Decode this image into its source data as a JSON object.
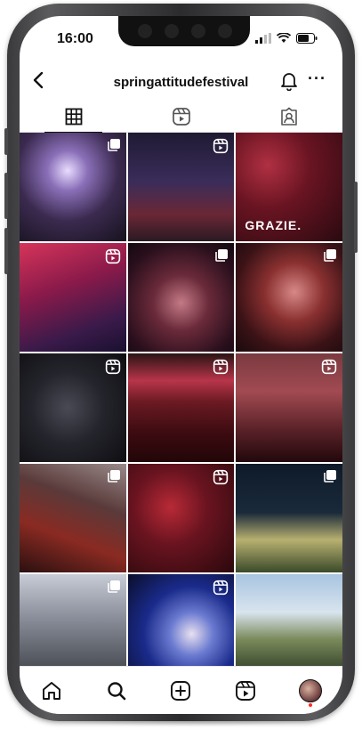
{
  "status_bar": {
    "time": "16:00"
  },
  "header": {
    "username": "springattitudefestival",
    "more_label": "···"
  },
  "tabs": [
    {
      "icon": "grid-icon",
      "active": true
    },
    {
      "icon": "reels-icon",
      "active": false
    },
    {
      "icon": "tagged-icon",
      "active": false
    }
  ],
  "posts": [
    {
      "type": "multi",
      "overlay_text": "",
      "bg": "radial-gradient(circle at 45% 35%, #e8dcff 0%, #8a6fb8 22%, #3b2a4f 55%, #16121e 100%)"
    },
    {
      "type": "reel",
      "overlay_text": "",
      "bg": "linear-gradient(180deg,#1f1a33 0%,#3a2d5a 45%,#6a2736 75%,#2a1a22 100%)"
    },
    {
      "type": "none",
      "overlay_text": "GRAZIE.",
      "bg": "radial-gradient(circle at 30% 30%, #b03042 0%, #6a1422 40%, #2a0a10 100%)"
    },
    {
      "type": "reel",
      "overlay_text": "",
      "bg": "linear-gradient(160deg,#d6345a 0%,#8a1a4a 40%,#3a1a4a 75%,#1a1030 100%)"
    },
    {
      "type": "multi",
      "overlay_text": "",
      "bg": "radial-gradient(circle at 50% 55%, #c47a86 0%, #6a2a3a 35%, #2a0f1c 75%, #120810 100%)"
    },
    {
      "type": "multi",
      "overlay_text": "",
      "bg": "radial-gradient(circle at 55% 45%, #d88888 0%, #8a3030 35%, #3a1216 70%, #1a0a0c 100%)"
    },
    {
      "type": "reel",
      "overlay_text": "",
      "bg": "radial-gradient(circle at 45% 50%, #4a4a55 0%, #24242c 45%, #0e0e12 100%)"
    },
    {
      "type": "reel",
      "overlay_text": "",
      "bg": "linear-gradient(180deg,#2a1414 0%,#b8344a 25%,#6a1a22 45%,#3a0a10 75%,#220608 100%)"
    },
    {
      "type": "reel",
      "overlay_text": "",
      "bg": "linear-gradient(180deg,#7a3a40 0%,#a24a52 35%,#5a2228 70%,#22080c 100%)"
    },
    {
      "type": "multi",
      "overlay_text": "",
      "bg": "linear-gradient(200deg,#9a8a8a 0%,#5a3a3a 35%,#8a2a22 65%,#2a1010 100%)"
    },
    {
      "type": "reel",
      "overlay_text": "",
      "bg": "radial-gradient(circle at 40% 40%, #b82a36 0%, #6a1420 40%, #2a080c 100%)"
    },
    {
      "type": "multi",
      "overlay_text": "",
      "bg": "linear-gradient(180deg,#0e1a2a 0%,#1a2a3a 45%,#b8b070 70%,#3a4a2a 100%)"
    },
    {
      "type": "multi",
      "overlay_text": "",
      "bg": "linear-gradient(180deg,#c8ccd6 0%,#8a8e9a 40%,#5a5e66 75%,#3a3c42 100%)"
    },
    {
      "type": "reel",
      "overlay_text": "",
      "bg": "radial-gradient(circle at 60% 55%, #e8e0f0 0%, #6a7ad0 25%, #1a2a8a 55%, #0a0e2a 100%)"
    },
    {
      "type": "none",
      "overlay_text": "",
      "bg": "linear-gradient(180deg,#a8c4e0 0%,#d8e4ee 35%,#7a8a5a 60%,#4a5a3a 80%,#2a2e2a 100%)"
    }
  ],
  "nav": [
    {
      "icon": "home-icon"
    },
    {
      "icon": "search-icon"
    },
    {
      "icon": "create-post-icon"
    },
    {
      "icon": "reels-icon"
    },
    {
      "icon": "profile-avatar"
    }
  ],
  "colors": {
    "notification_dot": "#ff2a2a",
    "text": "#111111"
  }
}
